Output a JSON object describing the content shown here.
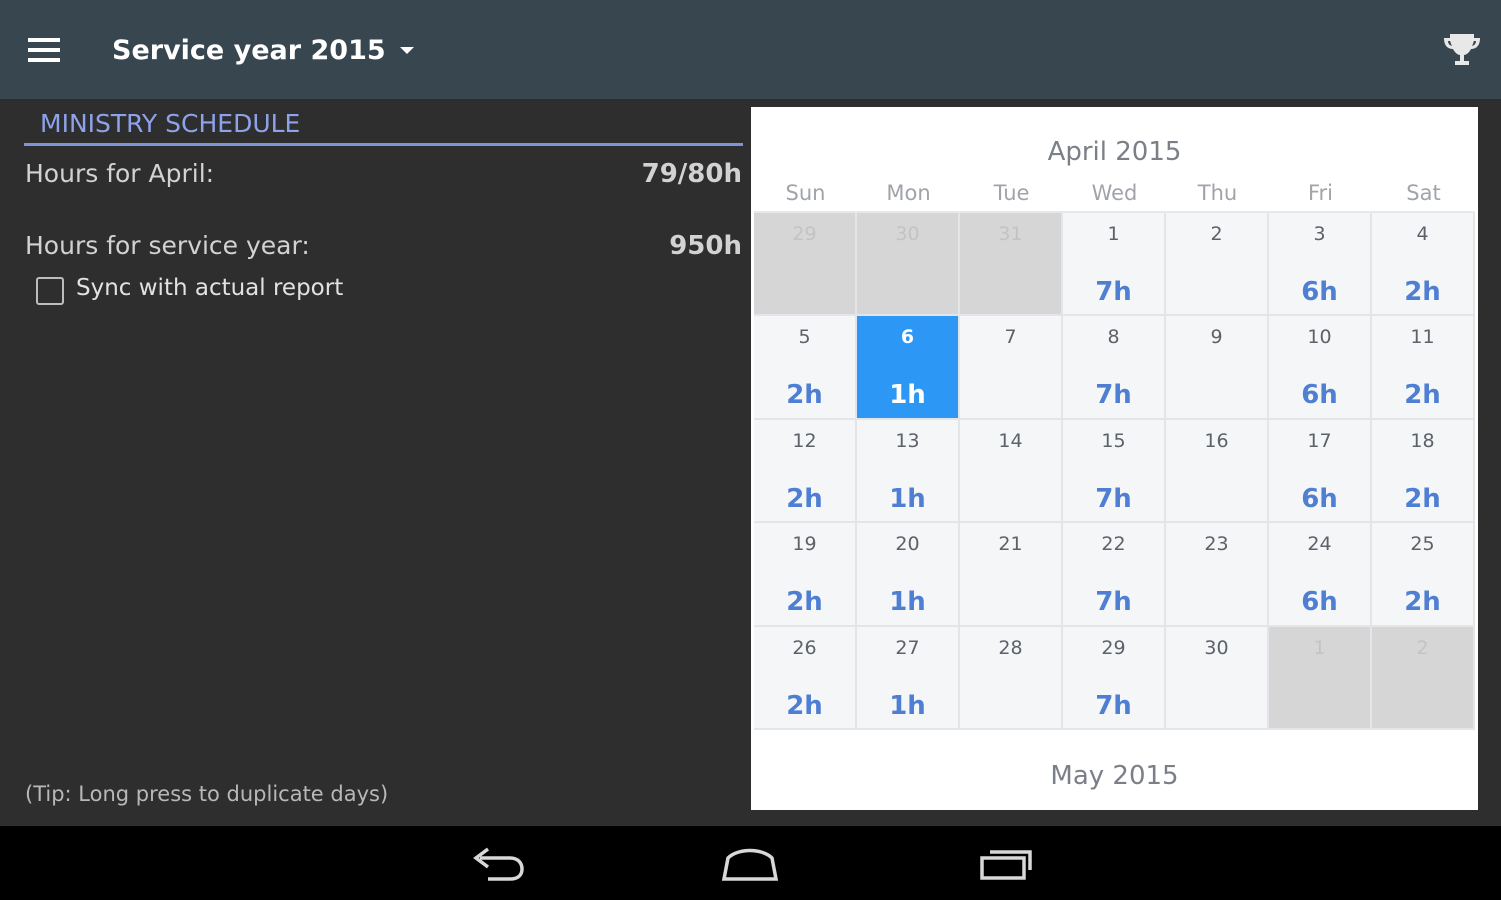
{
  "app_bar": {
    "title": "Service year 2015",
    "menu_icon": "hamburger-menu-icon",
    "trophy_icon": "trophy-icon"
  },
  "schedule": {
    "section_title": "MINISTRY SCHEDULE",
    "month_hours_label": "Hours for April:",
    "month_hours_value": "79/80h",
    "year_hours_label": "Hours for service year:",
    "year_hours_value": "950h",
    "sync_checkbox_label": "Sync with actual report",
    "sync_checked": false,
    "tip": "(Tip: Long press to duplicate days)"
  },
  "calendar": {
    "month_title": "April 2015",
    "next_month_title": "May 2015",
    "weekdays": [
      "Sun",
      "Mon",
      "Tue",
      "Wed",
      "Thu",
      "Fri",
      "Sat"
    ],
    "days": [
      {
        "day": "29",
        "hours": "",
        "state": "out"
      },
      {
        "day": "30",
        "hours": "",
        "state": "out"
      },
      {
        "day": "31",
        "hours": "",
        "state": "out"
      },
      {
        "day": "1",
        "hours": "7h",
        "state": "in"
      },
      {
        "day": "2",
        "hours": "",
        "state": "in"
      },
      {
        "day": "3",
        "hours": "6h",
        "state": "in"
      },
      {
        "day": "4",
        "hours": "2h",
        "state": "in"
      },
      {
        "day": "5",
        "hours": "2h",
        "state": "in"
      },
      {
        "day": "6",
        "hours": "1h",
        "state": "selected"
      },
      {
        "day": "7",
        "hours": "",
        "state": "in"
      },
      {
        "day": "8",
        "hours": "7h",
        "state": "in"
      },
      {
        "day": "9",
        "hours": "",
        "state": "in"
      },
      {
        "day": "10",
        "hours": "6h",
        "state": "in"
      },
      {
        "day": "11",
        "hours": "2h",
        "state": "in"
      },
      {
        "day": "12",
        "hours": "2h",
        "state": "in"
      },
      {
        "day": "13",
        "hours": "1h",
        "state": "in"
      },
      {
        "day": "14",
        "hours": "",
        "state": "in"
      },
      {
        "day": "15",
        "hours": "7h",
        "state": "in"
      },
      {
        "day": "16",
        "hours": "",
        "state": "in"
      },
      {
        "day": "17",
        "hours": "6h",
        "state": "in"
      },
      {
        "day": "18",
        "hours": "2h",
        "state": "in"
      },
      {
        "day": "19",
        "hours": "2h",
        "state": "in"
      },
      {
        "day": "20",
        "hours": "1h",
        "state": "in"
      },
      {
        "day": "21",
        "hours": "",
        "state": "in"
      },
      {
        "day": "22",
        "hours": "7h",
        "state": "in"
      },
      {
        "day": "23",
        "hours": "",
        "state": "in"
      },
      {
        "day": "24",
        "hours": "6h",
        "state": "in"
      },
      {
        "day": "25",
        "hours": "2h",
        "state": "in"
      },
      {
        "day": "26",
        "hours": "2h",
        "state": "in"
      },
      {
        "day": "27",
        "hours": "1h",
        "state": "in"
      },
      {
        "day": "28",
        "hours": "",
        "state": "in"
      },
      {
        "day": "29",
        "hours": "7h",
        "state": "in"
      },
      {
        "day": "30",
        "hours": "",
        "state": "in"
      },
      {
        "day": "1",
        "hours": "",
        "state": "out"
      },
      {
        "day": "2",
        "hours": "",
        "state": "out"
      }
    ]
  },
  "nav_bar": {
    "back_icon": "back-icon",
    "home_icon": "home-icon",
    "recents_icon": "recent-apps-icon"
  }
}
